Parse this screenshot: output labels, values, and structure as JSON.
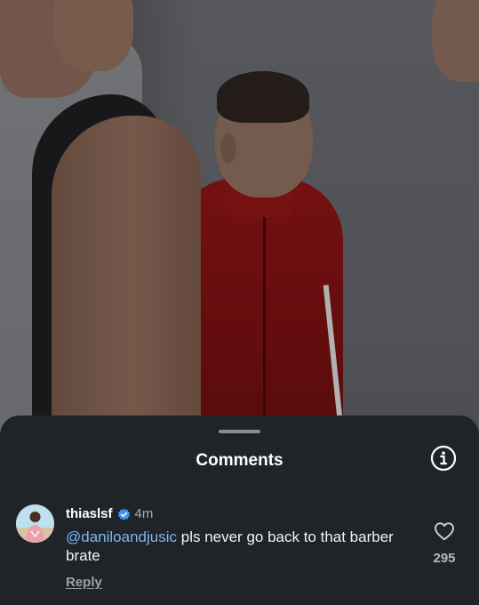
{
  "sheet": {
    "title": "Comments"
  },
  "icons": {
    "info": "info-circle-icon",
    "verified": "verified-badge-icon",
    "like": "heart-outline-icon"
  },
  "comment": {
    "username": "thiaslsf",
    "timestamp": "4m",
    "mention": "@daniloandjusic",
    "body": " pls never go back to that barber brate",
    "reply_label": "Reply",
    "like_count": "295"
  },
  "colors": {
    "sheet_bg": "#202327",
    "mention": "#7cb6f5",
    "verified": "#3b95f0",
    "secondary_text": "#a8abb0"
  }
}
